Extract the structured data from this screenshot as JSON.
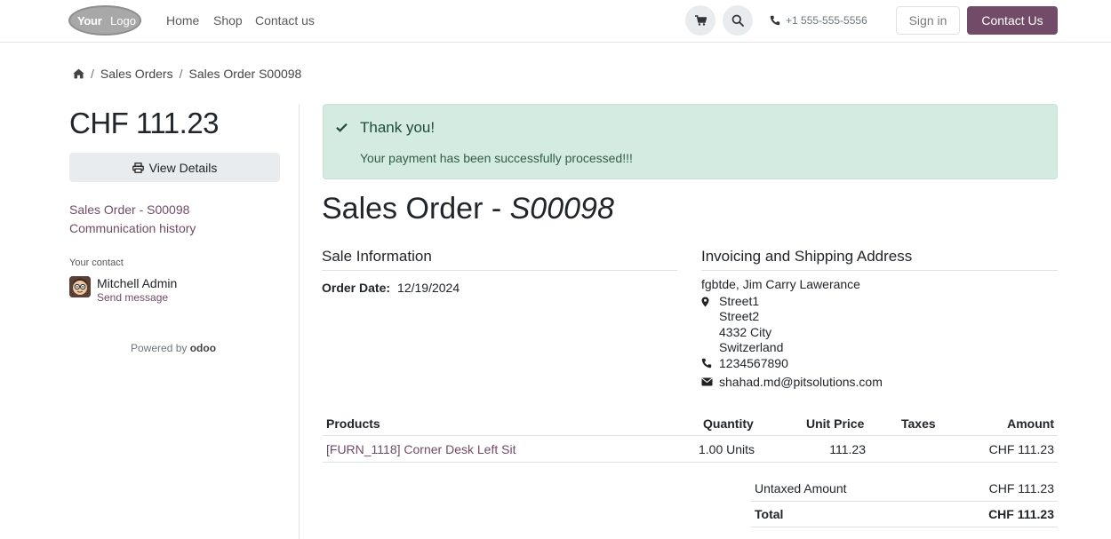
{
  "header": {
    "logo_part1": "Your",
    "logo_part2": "Logo",
    "nav": [
      "Home",
      "Shop",
      "Contact us"
    ],
    "phone": "+1 555-555-5556",
    "sign_in": "Sign in",
    "contact_us": "Contact Us",
    "icons": [
      "cart-icon",
      "search-icon",
      "phone-icon"
    ]
  },
  "breadcrumb": {
    "home_icon": "home-icon",
    "items": [
      "Sales Orders",
      "Sales Order S00098"
    ]
  },
  "sidebar": {
    "total": "CHF 111.23",
    "view_details": "View Details",
    "links": [
      "Sales Order - S00098",
      "Communication history"
    ],
    "contact_caption": "Your contact",
    "contact_name": "Mitchell Admin",
    "send_message": "Send message",
    "powered_by": "Powered by",
    "powered_brand": "odoo"
  },
  "alert": {
    "title": "Thank you!",
    "body": "Your payment has been successfully processed!!!"
  },
  "order": {
    "title_prefix": "Sales Order - ",
    "number": "S00098",
    "sale_info_heading": "Sale Information",
    "order_date_label": "Order Date:",
    "order_date": "12/19/2024",
    "address_heading": "Invoicing and Shipping Address",
    "address_name": "fgbtde, Jim Carry Lawerance",
    "address_lines": [
      "Street1",
      "Street2",
      "4332 City",
      "Switzerland"
    ],
    "phone": "1234567890",
    "email": "shahad.md@pitsolutions.com"
  },
  "table": {
    "headers": [
      "Products",
      "Quantity",
      "Unit Price",
      "Taxes",
      "Amount"
    ],
    "rows": [
      {
        "product": "[FURN_1118] Corner Desk Left Sit",
        "quantity": "1.00 Units",
        "unit_price": "111.23",
        "taxes": "",
        "amount": "CHF 111.23"
      }
    ],
    "untaxed_label": "Untaxed Amount",
    "untaxed_value": "CHF 111.23",
    "total_label": "Total",
    "total_value": "CHF 111.23"
  },
  "colors": {
    "brand": "#714b67",
    "alert_bg": "#d4ebe1"
  }
}
